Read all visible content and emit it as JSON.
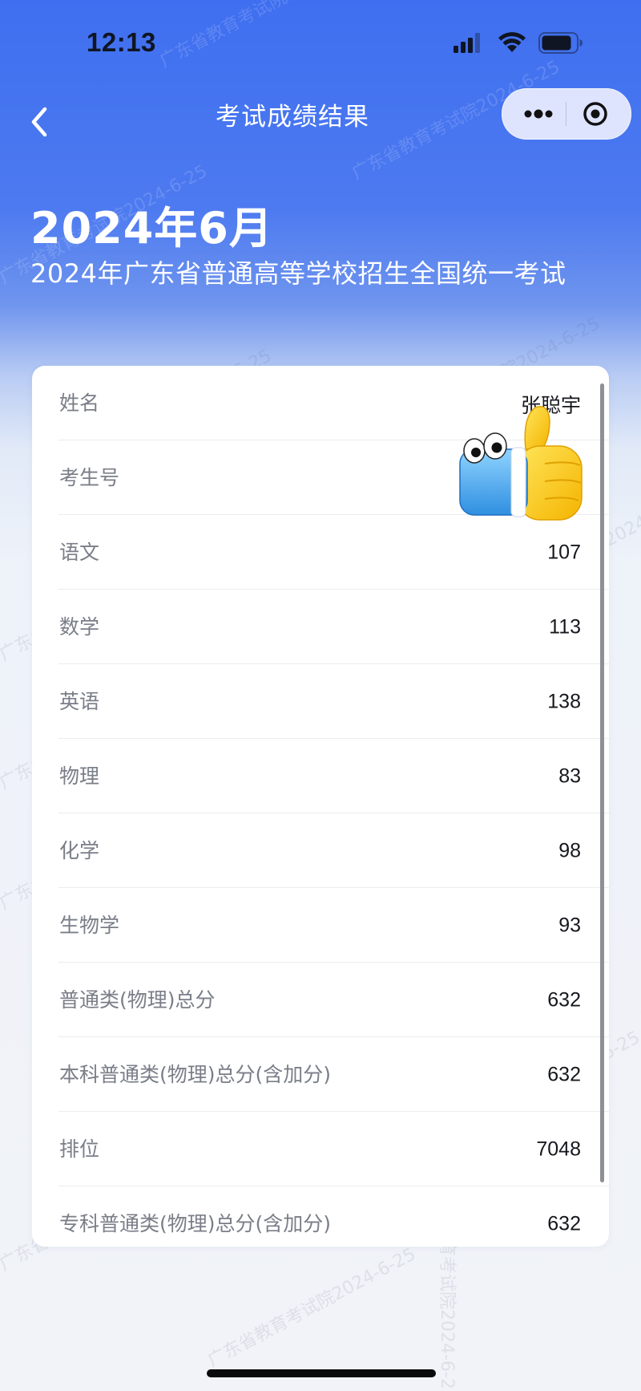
{
  "status_bar": {
    "time": "12:13"
  },
  "nav": {
    "title": "考试成绩结果"
  },
  "header": {
    "date": "2024年6月",
    "subtitle": "2024年广东省普通高等学校招生全国统一考试"
  },
  "scores": {
    "rows": [
      {
        "label": "姓名",
        "value": "张聪宇"
      },
      {
        "label": "考生号",
        "value": ""
      },
      {
        "label": "语文",
        "value": "107"
      },
      {
        "label": "数学",
        "value": "113"
      },
      {
        "label": "英语",
        "value": "138"
      },
      {
        "label": "物理",
        "value": "83"
      },
      {
        "label": "化学",
        "value": "98"
      },
      {
        "label": "生物学",
        "value": "93"
      },
      {
        "label": "普通类(物理)总分",
        "value": "632"
      },
      {
        "label": "本科普通类(物理)总分(含加分)",
        "value": "632"
      },
      {
        "label": "排位",
        "value": "7048"
      },
      {
        "label": "专科普通类(物理)总分(含加分)",
        "value": "632"
      }
    ]
  },
  "watermark": {
    "text": "广东省教育考试院2024-6-25"
  },
  "icons": {
    "back": "chevron-left-icon",
    "more": "more-dots-icon",
    "close": "target-circle-icon",
    "signal": "cellular-signal-icon",
    "wifi": "wifi-icon",
    "battery": "battery-icon",
    "sticker": "thumbs-up-sticker"
  },
  "colors": {
    "header_blue": "#3f6ff0",
    "card_bg": "#ffffff",
    "label_gray": "#7a7e88",
    "value_black": "#16181d"
  }
}
